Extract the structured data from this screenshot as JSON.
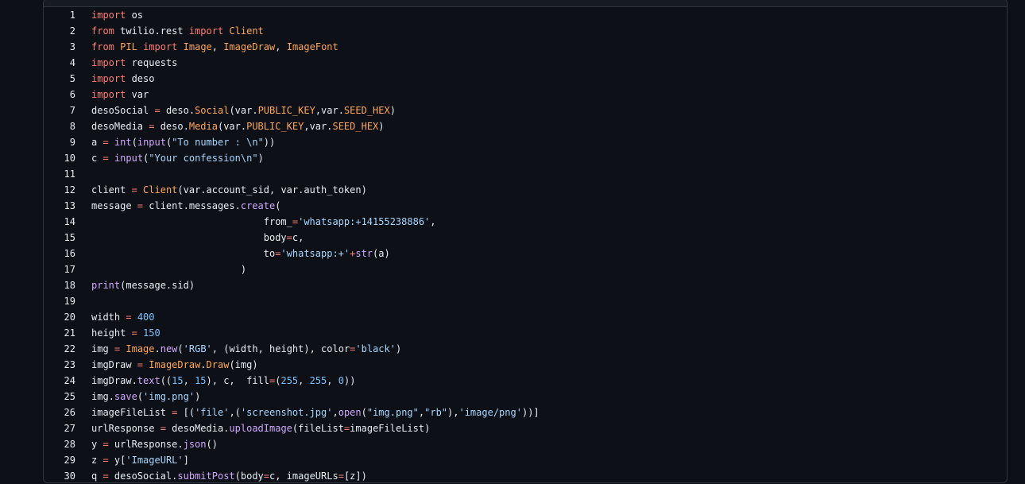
{
  "colors": {
    "background": "#0d1117",
    "keyword": "#ff7b72",
    "function": "#d2a8ff",
    "class": "#ffa657",
    "string": "#a5d6ff",
    "number": "#79c0ff",
    "text": "#e6edf3"
  },
  "code_lines": [
    {
      "n": "1",
      "tokens": [
        [
          "kw",
          "import"
        ],
        [
          "pl",
          " os"
        ]
      ]
    },
    {
      "n": "2",
      "tokens": [
        [
          "kw",
          "from"
        ],
        [
          "pl",
          " twilio.rest "
        ],
        [
          "kw",
          "import"
        ],
        [
          "pl",
          " "
        ],
        [
          "cls",
          "Client"
        ]
      ]
    },
    {
      "n": "3",
      "tokens": [
        [
          "kw",
          "from"
        ],
        [
          "pl",
          " "
        ],
        [
          "cls",
          "PIL"
        ],
        [
          "pl",
          " "
        ],
        [
          "kw",
          "import"
        ],
        [
          "pl",
          " "
        ],
        [
          "cls",
          "Image"
        ],
        [
          "pl",
          ", "
        ],
        [
          "cls",
          "ImageDraw"
        ],
        [
          "pl",
          ", "
        ],
        [
          "cls",
          "ImageFont"
        ]
      ]
    },
    {
      "n": "4",
      "tokens": [
        [
          "kw",
          "import"
        ],
        [
          "pl",
          " requests"
        ]
      ]
    },
    {
      "n": "5",
      "tokens": [
        [
          "kw",
          "import"
        ],
        [
          "pl",
          " deso"
        ]
      ]
    },
    {
      "n": "6",
      "tokens": [
        [
          "kw",
          "import"
        ],
        [
          "pl",
          " var"
        ]
      ]
    },
    {
      "n": "7",
      "tokens": [
        [
          "pl",
          "desoSocial "
        ],
        [
          "op",
          "="
        ],
        [
          "pl",
          " deso."
        ],
        [
          "cls",
          "Social"
        ],
        [
          "pl",
          "(var."
        ],
        [
          "cls",
          "PUBLIC_KEY"
        ],
        [
          "pl",
          ",var."
        ],
        [
          "cls",
          "SEED_HEX"
        ],
        [
          "pl",
          ")"
        ]
      ]
    },
    {
      "n": "8",
      "tokens": [
        [
          "pl",
          "desoMedia "
        ],
        [
          "op",
          "="
        ],
        [
          "pl",
          " deso."
        ],
        [
          "cls",
          "Media"
        ],
        [
          "pl",
          "(var."
        ],
        [
          "cls",
          "PUBLIC_KEY"
        ],
        [
          "pl",
          ",var."
        ],
        [
          "cls",
          "SEED_HEX"
        ],
        [
          "pl",
          ")"
        ]
      ]
    },
    {
      "n": "9",
      "tokens": [
        [
          "pl",
          "a "
        ],
        [
          "op",
          "="
        ],
        [
          "pl",
          " "
        ],
        [
          "fn",
          "int"
        ],
        [
          "pl",
          "("
        ],
        [
          "fn",
          "input"
        ],
        [
          "pl",
          "("
        ],
        [
          "str",
          "\"To number : \\n\""
        ],
        [
          "pl",
          "))"
        ]
      ]
    },
    {
      "n": "10",
      "tokens": [
        [
          "pl",
          "c "
        ],
        [
          "op",
          "="
        ],
        [
          "pl",
          " "
        ],
        [
          "fn",
          "input"
        ],
        [
          "pl",
          "("
        ],
        [
          "str",
          "\"Your confession\\n\""
        ],
        [
          "pl",
          ")"
        ]
      ]
    },
    {
      "n": "11",
      "tokens": [
        [
          "pl",
          ""
        ]
      ]
    },
    {
      "n": "12",
      "tokens": [
        [
          "pl",
          "client "
        ],
        [
          "op",
          "="
        ],
        [
          "pl",
          " "
        ],
        [
          "cls",
          "Client"
        ],
        [
          "pl",
          "(var.account_sid, var.auth_token)"
        ]
      ]
    },
    {
      "n": "13",
      "tokens": [
        [
          "pl",
          "message "
        ],
        [
          "op",
          "="
        ],
        [
          "pl",
          " client.messages."
        ],
        [
          "fn",
          "create"
        ],
        [
          "pl",
          "("
        ]
      ]
    },
    {
      "n": "14",
      "tokens": [
        [
          "pl",
          "                              from_"
        ],
        [
          "op",
          "="
        ],
        [
          "str",
          "'whatsapp:+14155238886'"
        ],
        [
          "pl",
          ","
        ]
      ]
    },
    {
      "n": "15",
      "tokens": [
        [
          "pl",
          "                              body"
        ],
        [
          "op",
          "="
        ],
        [
          "pl",
          "c,"
        ]
      ]
    },
    {
      "n": "16",
      "tokens": [
        [
          "pl",
          "                              to"
        ],
        [
          "op",
          "="
        ],
        [
          "str",
          "'whatsapp:+'"
        ],
        [
          "op",
          "+"
        ],
        [
          "fn",
          "str"
        ],
        [
          "pl",
          "(a)"
        ]
      ]
    },
    {
      "n": "17",
      "tokens": [
        [
          "pl",
          "                          )"
        ]
      ]
    },
    {
      "n": "18",
      "tokens": [
        [
          "fn",
          "print"
        ],
        [
          "pl",
          "(message.sid)"
        ]
      ]
    },
    {
      "n": "19",
      "tokens": [
        [
          "pl",
          ""
        ]
      ]
    },
    {
      "n": "20",
      "tokens": [
        [
          "pl",
          "width "
        ],
        [
          "op",
          "="
        ],
        [
          "pl",
          " "
        ],
        [
          "num",
          "400"
        ]
      ]
    },
    {
      "n": "21",
      "tokens": [
        [
          "pl",
          "height "
        ],
        [
          "op",
          "="
        ],
        [
          "pl",
          " "
        ],
        [
          "num",
          "150"
        ]
      ]
    },
    {
      "n": "22",
      "tokens": [
        [
          "pl",
          "img "
        ],
        [
          "op",
          "="
        ],
        [
          "pl",
          " "
        ],
        [
          "cls",
          "Image"
        ],
        [
          "pl",
          "."
        ],
        [
          "fn",
          "new"
        ],
        [
          "pl",
          "("
        ],
        [
          "str",
          "'RGB'"
        ],
        [
          "pl",
          ", (width, height), color"
        ],
        [
          "op",
          "="
        ],
        [
          "str",
          "'black'"
        ],
        [
          "pl",
          ")"
        ]
      ]
    },
    {
      "n": "23",
      "tokens": [
        [
          "pl",
          "imgDraw "
        ],
        [
          "op",
          "="
        ],
        [
          "pl",
          " "
        ],
        [
          "cls",
          "ImageDraw"
        ],
        [
          "pl",
          "."
        ],
        [
          "cls",
          "Draw"
        ],
        [
          "pl",
          "(img)"
        ]
      ]
    },
    {
      "n": "24",
      "tokens": [
        [
          "pl",
          "imgDraw."
        ],
        [
          "fn",
          "text"
        ],
        [
          "pl",
          "(("
        ],
        [
          "num",
          "15"
        ],
        [
          "pl",
          ", "
        ],
        [
          "num",
          "15"
        ],
        [
          "pl",
          "), c,  fill"
        ],
        [
          "op",
          "="
        ],
        [
          "pl",
          "("
        ],
        [
          "num",
          "255"
        ],
        [
          "pl",
          ", "
        ],
        [
          "num",
          "255"
        ],
        [
          "pl",
          ", "
        ],
        [
          "num",
          "0"
        ],
        [
          "pl",
          "))"
        ]
      ]
    },
    {
      "n": "25",
      "tokens": [
        [
          "pl",
          "img."
        ],
        [
          "fn",
          "save"
        ],
        [
          "pl",
          "("
        ],
        [
          "str",
          "'img.png'"
        ],
        [
          "pl",
          ")"
        ]
      ]
    },
    {
      "n": "26",
      "tokens": [
        [
          "pl",
          "imageFileList "
        ],
        [
          "op",
          "="
        ],
        [
          "pl",
          " [("
        ],
        [
          "str",
          "'file'"
        ],
        [
          "pl",
          ",("
        ],
        [
          "str",
          "'screenshot.jpg'"
        ],
        [
          "pl",
          ","
        ],
        [
          "fn",
          "open"
        ],
        [
          "pl",
          "("
        ],
        [
          "str",
          "\"img.png\""
        ],
        [
          "pl",
          ","
        ],
        [
          "str",
          "\"rb\""
        ],
        [
          "pl",
          "),"
        ],
        [
          "str",
          "'image/png'"
        ],
        [
          "pl",
          "))]"
        ]
      ]
    },
    {
      "n": "27",
      "tokens": [
        [
          "pl",
          "urlResponse "
        ],
        [
          "op",
          "="
        ],
        [
          "pl",
          " desoMedia."
        ],
        [
          "fn",
          "uploadImage"
        ],
        [
          "pl",
          "(fileList"
        ],
        [
          "op",
          "="
        ],
        [
          "pl",
          "imageFileList)"
        ]
      ]
    },
    {
      "n": "28",
      "tokens": [
        [
          "pl",
          "y "
        ],
        [
          "op",
          "="
        ],
        [
          "pl",
          " urlResponse."
        ],
        [
          "fn",
          "json"
        ],
        [
          "pl",
          "()"
        ]
      ]
    },
    {
      "n": "29",
      "tokens": [
        [
          "pl",
          "z "
        ],
        [
          "op",
          "="
        ],
        [
          "pl",
          " y["
        ],
        [
          "str",
          "'ImageURL'"
        ],
        [
          "pl",
          "]"
        ]
      ]
    },
    {
      "n": "30",
      "tokens": [
        [
          "pl",
          "q "
        ],
        [
          "op",
          "="
        ],
        [
          "pl",
          " desoSocial."
        ],
        [
          "fn",
          "submitPost"
        ],
        [
          "pl",
          "(body"
        ],
        [
          "op",
          "="
        ],
        [
          "pl",
          "c, imageURLs"
        ],
        [
          "op",
          "="
        ],
        [
          "pl",
          "[z])"
        ]
      ]
    }
  ]
}
